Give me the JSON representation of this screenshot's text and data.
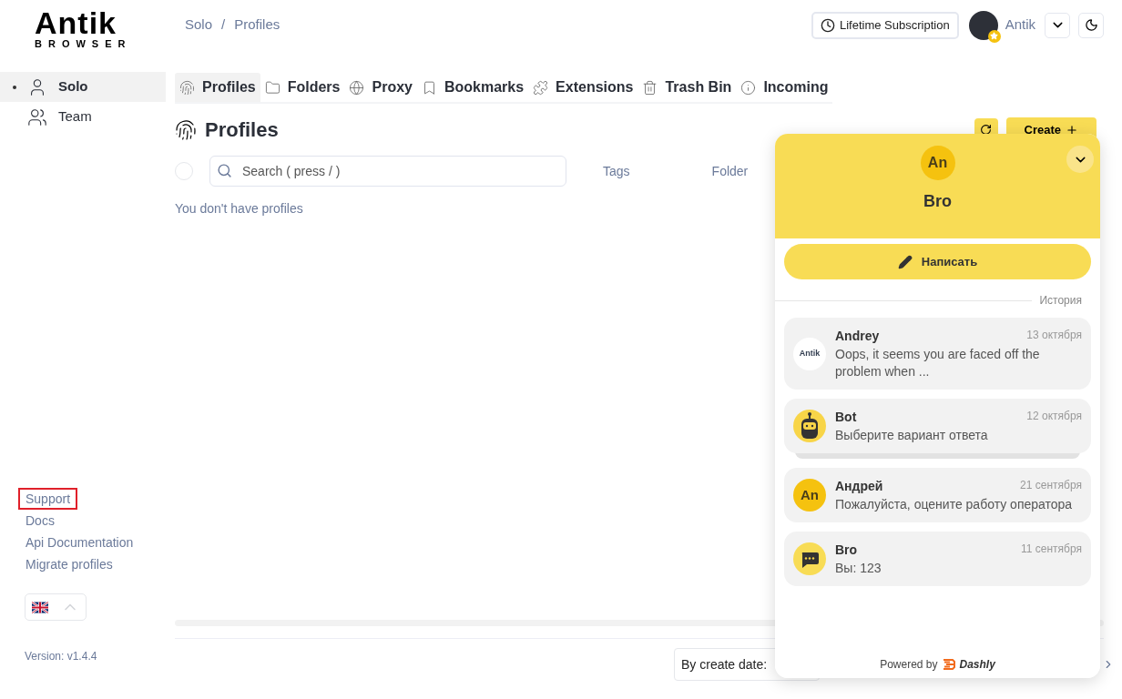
{
  "logo": {
    "name": "Antik",
    "subtitle": "BROWSER"
  },
  "breadcrumb": {
    "items": [
      "Solo",
      "Profiles"
    ],
    "separator": "/"
  },
  "header": {
    "subscription": "Lifetime Subscription",
    "user": "Antik"
  },
  "sidebar": {
    "items": [
      {
        "label": "Solo",
        "kind": "solo",
        "selected": true
      },
      {
        "label": "Team",
        "kind": "team",
        "selected": false
      }
    ],
    "links": [
      {
        "label": "Support",
        "highlighted": true
      },
      {
        "label": "Docs",
        "highlighted": false
      },
      {
        "label": "Api Documentation",
        "highlighted": false
      },
      {
        "label": "Migrate profiles",
        "highlighted": false
      }
    ],
    "version": "Version: v1.4.4"
  },
  "tabs": [
    {
      "label": "Profiles",
      "kind": "fingerprint",
      "selected": true
    },
    {
      "label": "Folders",
      "kind": "folder",
      "selected": false
    },
    {
      "label": "Proxy",
      "kind": "globe",
      "selected": false
    },
    {
      "label": "Bookmarks",
      "kind": "bookmark",
      "selected": false
    },
    {
      "label": "Extensions",
      "kind": "puzzle",
      "selected": false
    },
    {
      "label": "Trash Bin",
      "kind": "trash",
      "selected": false
    },
    {
      "label": "Incoming",
      "kind": "info",
      "selected": false
    }
  ],
  "page": {
    "select_all": {
      "checked": false
    },
    "title": "Profiles",
    "create": "Create",
    "search_placeholder": "Search ( press / )",
    "filters": [
      "Tags",
      "Folder"
    ],
    "empty": "You don't have profiles",
    "sort": "By create date:"
  },
  "chat": {
    "title": "Bro",
    "avatar_text": "An",
    "compose": "Написать",
    "history": "История",
    "conversations": [
      {
        "name": "Andrey",
        "date": "13 октября",
        "text": "Oops, it seems you are faced off the problem when ...",
        "kind": "logo",
        "avatar_text": "Antik"
      },
      {
        "name": "Bot",
        "date": "12 октября",
        "text": "Выберите вариант ответа",
        "kind": "bot",
        "stacked": true
      },
      {
        "name": "Андрей",
        "date": "21 сентября",
        "text": "Пожалуйста, оцените работу оператора",
        "kind": "monogram",
        "avatar_text": "An"
      },
      {
        "name": "Bro",
        "date": "11 сентября",
        "text": "Вы: 123",
        "kind": "chat"
      }
    ],
    "powered": "Powered by",
    "brand": "Dashly"
  }
}
